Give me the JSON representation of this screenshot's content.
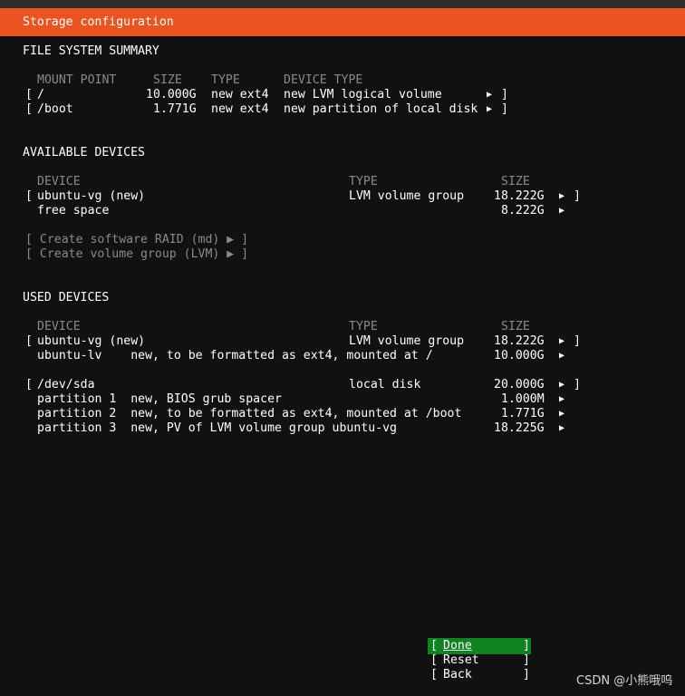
{
  "title": "Storage configuration",
  "fs_summary": {
    "heading": "FILE SYSTEM SUMMARY",
    "headers": {
      "mount": "MOUNT POINT",
      "size": "SIZE",
      "type": "TYPE",
      "device_type": "DEVICE TYPE"
    },
    "rows": [
      {
        "open": "[",
        "mount": "/",
        "size": "10.000G",
        "type": "new ext4",
        "device_type": "new LVM logical volume",
        "arrow": "▶",
        "close": "]"
      },
      {
        "open": "[",
        "mount": "/boot",
        "size": "1.771G",
        "type": "new ext4",
        "device_type": "new partition of local disk",
        "arrow": "▶",
        "close": "]"
      }
    ]
  },
  "available": {
    "heading": "AVAILABLE DEVICES",
    "headers": {
      "device": "DEVICE",
      "type": "TYPE",
      "size": "SIZE"
    },
    "rows": [
      {
        "open": "[",
        "device": "ubuntu-vg (new)",
        "type": "LVM volume group",
        "size": "18.222G",
        "arrow": "▶",
        "close": "]"
      },
      {
        "open": "",
        "device": "free space",
        "type": "",
        "size": "8.222G",
        "arrow": "▶",
        "close": ""
      }
    ],
    "actions": [
      {
        "label": "[ Create software RAID (md) ▶ ]"
      },
      {
        "label": "[ Create volume group (LVM) ▶ ]"
      }
    ]
  },
  "used": {
    "heading": "USED DEVICES",
    "headers": {
      "device": "DEVICE",
      "type": "TYPE",
      "size": "SIZE"
    },
    "rows": [
      {
        "open": "[",
        "device": "ubuntu-vg (new)",
        "type": "LVM volume group",
        "size": "18.222G",
        "arrow": "▶",
        "close": "]"
      },
      {
        "open": "",
        "device": "ubuntu-lv    new, to be formatted as ext4, mounted at /",
        "type": "",
        "size": "10.000G",
        "arrow": "▶",
        "close": ""
      },
      {
        "open": "[",
        "device": "/dev/sda",
        "type": "local disk",
        "size": "20.000G",
        "arrow": "▶",
        "close": "]"
      },
      {
        "open": "",
        "device": "partition 1  new, BIOS grub spacer",
        "type": "",
        "size": "1.000M",
        "arrow": "▶",
        "close": ""
      },
      {
        "open": "",
        "device": "partition 2  new, to be formatted as ext4, mounted at /boot",
        "type": "",
        "size": "1.771G",
        "arrow": "▶",
        "close": ""
      },
      {
        "open": "",
        "device": "partition 3  new, PV of LVM volume group ubuntu-vg",
        "type": "",
        "size": "18.225G",
        "arrow": "▶",
        "close": ""
      }
    ]
  },
  "buttons": {
    "bracket_open": "[",
    "bracket_close": "]",
    "done": "Done",
    "reset": "Reset",
    "back": "Back"
  },
  "watermark": "CSDN @小熊哦呜",
  "colors": {
    "title_bar": "#e95420",
    "background": "#111111",
    "focused_button": "#0e8420",
    "disabled_text": "#8a8a8a"
  }
}
